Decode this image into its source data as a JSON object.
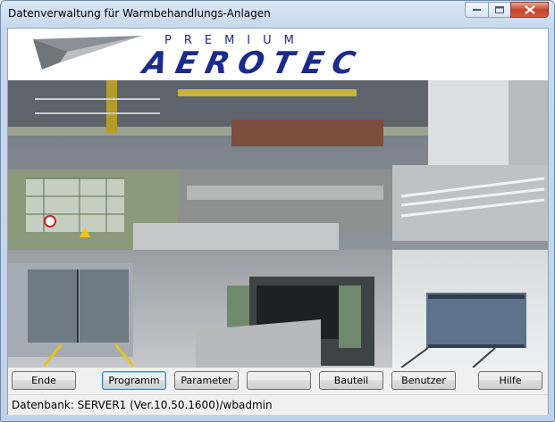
{
  "window": {
    "title": "Datenverwaltung für Warmbehandlungs-Anlagen"
  },
  "banner": {
    "brand_top": "PREMIUM",
    "brand_main": "AEROTEC",
    "brand_color": "#1a2b8c"
  },
  "buttons": [
    {
      "label": "Ende"
    },
    {
      "label": "Programm"
    },
    {
      "label": "Parameter"
    },
    {
      "label": ""
    },
    {
      "label": "Bauteil"
    },
    {
      "label": "Benutzer"
    },
    {
      "label": "Hilfe"
    }
  ],
  "status": {
    "text": "Datenbank: SERVER1 (Ver.10.50.1600)/wbadmin"
  }
}
